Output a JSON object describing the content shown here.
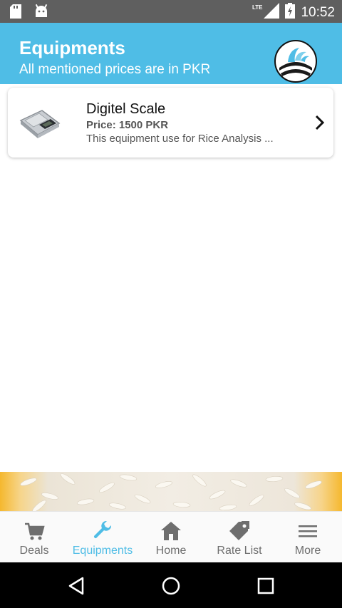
{
  "status_bar": {
    "network": "LTE",
    "time": "10:52"
  },
  "header": {
    "title": "Equipments",
    "subtitle": "All mentioned prices are in PKR"
  },
  "equipment_list": [
    {
      "name": "Digitel Scale",
      "price": "Price: 1500 PKR",
      "description": "This equipment use for Rice Analysis ..."
    }
  ],
  "bottom_nav": {
    "active": "Equipments",
    "items": [
      {
        "label": "Deals",
        "icon": "cart-icon"
      },
      {
        "label": "Equipments",
        "icon": "wrench-icon"
      },
      {
        "label": "Home",
        "icon": "home-icon"
      },
      {
        "label": "Rate List",
        "icon": "tag-icon"
      },
      {
        "label": "More",
        "icon": "menu-icon"
      }
    ]
  },
  "colors": {
    "accent": "#4fbde6",
    "status_bar": "#5f5f5f",
    "nav_inactive": "#6e6e6e"
  }
}
